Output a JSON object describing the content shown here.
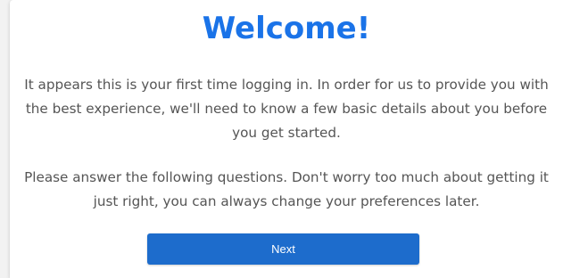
{
  "welcome": {
    "title": "Welcome!",
    "paragraph_1": "It appears this is your first time logging in. In order for us to provide you with the best experience, we'll need to know a few basic details about you before you get started.",
    "paragraph_2": "Please answer the following questions. Don't worry too much about getting it just right, you can always change your preferences later.",
    "next_label": "Next"
  },
  "colors": {
    "title": "#1a73e8",
    "button": "#1d6ccc",
    "body_text": "#555555",
    "background": "#ffffff"
  }
}
